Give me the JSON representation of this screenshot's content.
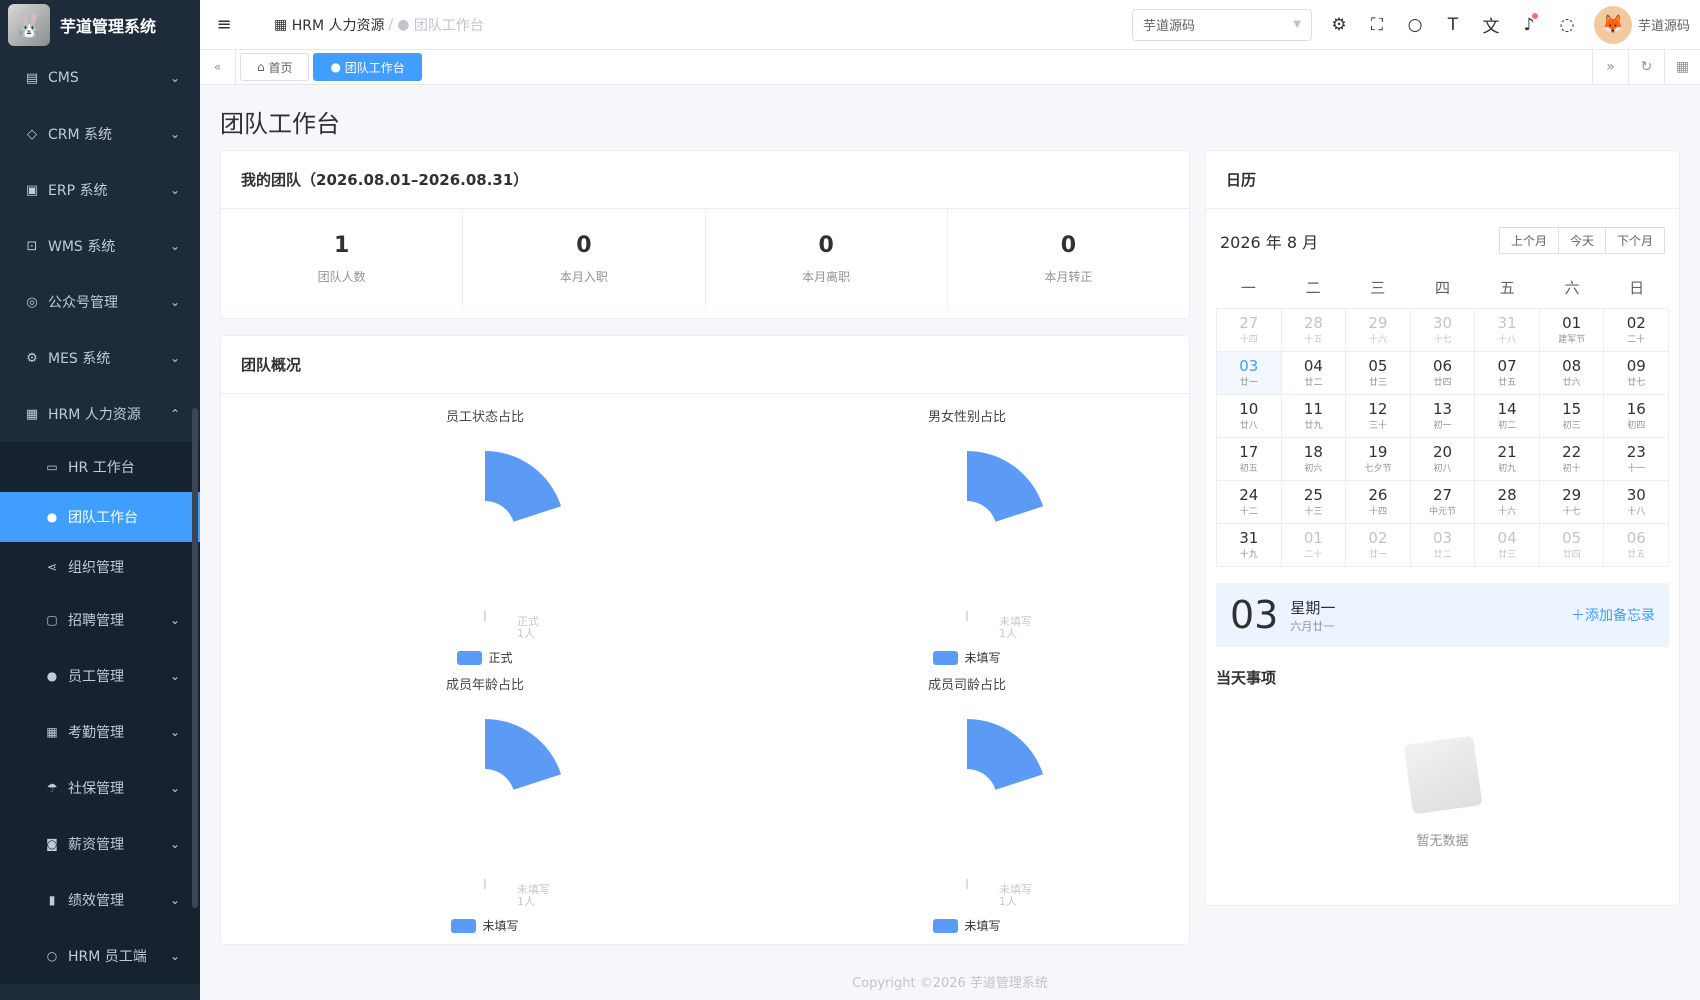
{
  "app": {
    "title": "芋道管理系统",
    "logo_icon": "🐰"
  },
  "sidebar": {
    "items": [
      {
        "label": "CMS",
        "icon": "doc-icon"
      },
      {
        "label": "CRM 系统",
        "icon": "tag-icon"
      },
      {
        "label": "ERP 系统",
        "icon": "erp-icon"
      },
      {
        "label": "WMS 系统",
        "icon": "box-icon"
      },
      {
        "label": "公众号管理",
        "icon": "compass-icon"
      },
      {
        "label": "MES 系统",
        "icon": "chip-icon"
      },
      {
        "label": "HRM 人力资源",
        "icon": "building-icon"
      }
    ],
    "sub": [
      {
        "label": "HR 工作台"
      },
      {
        "label": "团队工作台"
      },
      {
        "label": "组织管理"
      },
      {
        "label": "招聘管理"
      },
      {
        "label": "员工管理"
      },
      {
        "label": "考勤管理"
      },
      {
        "label": "社保管理"
      },
      {
        "label": "薪资管理"
      },
      {
        "label": "绩效管理"
      },
      {
        "label": "HRM 员工端"
      }
    ]
  },
  "navbar": {
    "breadcrumb": [
      "HRM 人力资源",
      "团队工作台"
    ],
    "tenant": "芋道源码",
    "user": "芋道源码"
  },
  "tags": {
    "home": "首页",
    "current": "团队工作台"
  },
  "page": {
    "title": "团队工作台"
  },
  "team": {
    "title": "我的团队（2026.08.01–2026.08.31）",
    "stats": [
      {
        "value": "1",
        "label": "团队人数"
      },
      {
        "value": "0",
        "label": "本月入职"
      },
      {
        "value": "0",
        "label": "本月离职"
      },
      {
        "value": "0",
        "label": "本月转正"
      }
    ]
  },
  "overview": {
    "title": "团队概况",
    "charts": [
      {
        "title": "员工状态占比",
        "slice": "正式",
        "count": "1人",
        "legend": "正式"
      },
      {
        "title": "男女性别占比",
        "slice": "未填写",
        "count": "1人",
        "legend": "未填写"
      },
      {
        "title": "成员年龄占比",
        "slice": "未填写",
        "count": "1人",
        "legend": "未填写"
      },
      {
        "title": "成员司龄占比",
        "slice": "未填写",
        "count": "1人",
        "legend": "未填写"
      }
    ]
  },
  "chart_data": [
    {
      "type": "pie",
      "title": "员工状态占比",
      "categories": [
        "正式"
      ],
      "values": [
        1
      ],
      "legend": "bottom"
    },
    {
      "type": "pie",
      "title": "男女性别占比",
      "categories": [
        "未填写"
      ],
      "values": [
        1
      ],
      "legend": "bottom"
    },
    {
      "type": "pie",
      "title": "成员年龄占比",
      "categories": [
        "未填写"
      ],
      "values": [
        1
      ],
      "legend": "bottom"
    },
    {
      "type": "pie",
      "title": "成员司龄占比",
      "categories": [
        "未填写"
      ],
      "values": [
        1
      ],
      "legend": "bottom"
    }
  ],
  "calendar": {
    "title": "日历",
    "year_month": "2026 年 8 月",
    "btn_prev": "上个月",
    "btn_today": "今天",
    "btn_next": "下个月",
    "weekdays": [
      "一",
      "二",
      "三",
      "四",
      "五",
      "六",
      "日"
    ],
    "weeks": [
      [
        [
          "27",
          "十四",
          1
        ],
        [
          "28",
          "十五",
          1
        ],
        [
          "29",
          "十六",
          1
        ],
        [
          "30",
          "十七",
          1
        ],
        [
          "31",
          "十八",
          1
        ],
        [
          "01",
          "建军节",
          0
        ],
        [
          "02",
          "二十",
          0
        ]
      ],
      [
        [
          "03",
          "廿一",
          2
        ],
        [
          "04",
          "廿二",
          0
        ],
        [
          "05",
          "廿三",
          0
        ],
        [
          "06",
          "廿四",
          0
        ],
        [
          "07",
          "廿五",
          0
        ],
        [
          "08",
          "廿六",
          0
        ],
        [
          "09",
          "廿七",
          0
        ]
      ],
      [
        [
          "10",
          "廿八",
          0
        ],
        [
          "11",
          "廿九",
          0
        ],
        [
          "12",
          "三十",
          0
        ],
        [
          "13",
          "初一",
          0
        ],
        [
          "14",
          "初二",
          0
        ],
        [
          "15",
          "初三",
          0
        ],
        [
          "16",
          "初四",
          0
        ]
      ],
      [
        [
          "17",
          "初五",
          0
        ],
        [
          "18",
          "初六",
          0
        ],
        [
          "19",
          "七夕节",
          0
        ],
        [
          "20",
          "初八",
          0
        ],
        [
          "21",
          "初九",
          0
        ],
        [
          "22",
          "初十",
          0
        ],
        [
          "23",
          "十一",
          0
        ]
      ],
      [
        [
          "24",
          "十二",
          0
        ],
        [
          "25",
          "十三",
          0
        ],
        [
          "26",
          "十四",
          0
        ],
        [
          "27",
          "中元节",
          0
        ],
        [
          "28",
          "十六",
          0
        ],
        [
          "29",
          "十七",
          0
        ],
        [
          "30",
          "十八",
          0
        ]
      ],
      [
        [
          "31",
          "十九",
          0
        ],
        [
          "01",
          "二十",
          1
        ],
        [
          "02",
          "廿一",
          1
        ],
        [
          "03",
          "廿二",
          1
        ],
        [
          "04",
          "廿三",
          1
        ],
        [
          "05",
          "廿四",
          1
        ],
        [
          "06",
          "廿五",
          1
        ]
      ]
    ],
    "selected_day": "03",
    "selected_weekday": "星期一",
    "selected_lunar": "六月廿一",
    "add_memo": "添加备忘录",
    "today_title": "当天事项",
    "empty": "暂无数据"
  },
  "footer": "Copyright ©2026 芋道管理系统",
  "colors": {
    "accent": "#409eff",
    "sidebar": "#1d2b3a",
    "pie": "#5b9bf5"
  }
}
